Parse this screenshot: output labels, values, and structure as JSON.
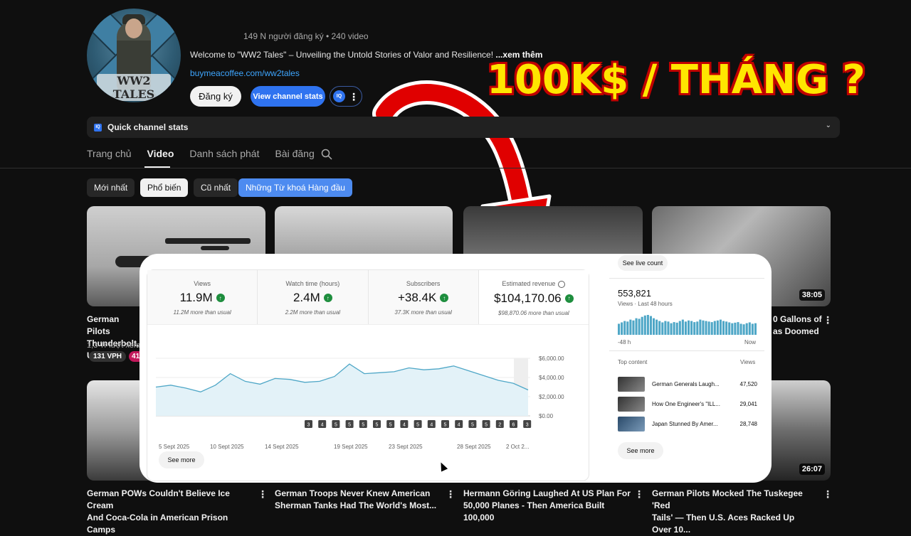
{
  "channel": {
    "avatar_text": "WW2 TALES",
    "sub_line": "149 N người đăng ký • 240 video",
    "description": "Welcome to \"WW2 Tales\" – Unveiling the Untold Stories of Valor and Resilience!",
    "more_link": "...xem thêm",
    "external_link": "buymeacoffee.com/ww2tales",
    "subscribe_label": "Đăng ký",
    "stats_button": "View channel stats",
    "iq_badge": "IQ"
  },
  "quick_stats": {
    "icon": "IQ",
    "label": "Quick channel stats"
  },
  "tabs": [
    "Trang chủ",
    "Video",
    "Danh sách phát",
    "Bài đăng"
  ],
  "chips": [
    "Mới nhất",
    "Phổ biến",
    "Cũ nhất",
    "Những Từ khoá Hàng đầu"
  ],
  "videos": [
    {
      "title_1": "German Pilots",
      "title_2": "Thunderbolt, U",
      "meta": "1,3 Tr lượt xem •",
      "vph": "131 VPH",
      "vph2": "41x"
    },
    {
      "title_1": "0 Gallons of",
      "title_2": "as Doomed",
      "duration": "38:05"
    },
    {
      "title_1": "German POWs Couldn't Believe Ice Cream",
      "title_2": "And Coca-Cola in American Prison Camps"
    },
    {
      "title_1": "German Troops Never Knew American",
      "title_2": "Sherman Tanks Had The World's Most..."
    },
    {
      "title_1": "Hermann Göring Laughed At US Plan For",
      "title_2": "50,000 Planes - Then America Built 100,000"
    },
    {
      "title_1": "German Pilots Mocked The Tuskegee 'Red",
      "title_2": "Tails' — Then U.S. Aces Racked Up Over 10...",
      "duration": "26:07"
    }
  ],
  "headline": "100K$ / THÁNG ?",
  "overlay": {
    "stats": [
      {
        "label": "Views",
        "value": "11.9M",
        "sub": "11.2M more than usual"
      },
      {
        "label": "Watch time (hours)",
        "value": "2.4M",
        "sub": "2.2M more than usual"
      },
      {
        "label": "Subscribers",
        "value": "+38.4K",
        "sub": "37.3K more than usual"
      },
      {
        "label": "Estimated revenue",
        "value": "$104,170.06",
        "sub": "$98,870.06 more than usual"
      }
    ],
    "see_more": "See more",
    "right": {
      "see_live": "See live count",
      "live_value": "553,821",
      "live_caption": "Views · Last 48 hours",
      "x_start": "-48 h",
      "x_end": "Now",
      "top_content": "Top content",
      "views_header": "Views",
      "items": [
        {
          "title": "German Generals Laugh...",
          "views": "47,520"
        },
        {
          "title": "How One Engineer's \"ILL...",
          "views": "29,041"
        },
        {
          "title": "Japan Stunned By Amer...",
          "views": "28,748"
        }
      ],
      "see_more": "See more"
    }
  },
  "chart_data": {
    "type": "area",
    "xlabels": [
      "5 Sept 2025",
      "10 Sept 2025",
      "14 Sept 2025",
      "19 Sept 2025",
      "23 Sept 2025",
      "28 Sept 2025",
      "2 Oct 2..."
    ],
    "yticks": [
      "$6,000.00",
      "$4,000.00",
      "$2,000.00",
      "$0.00"
    ],
    "ylim": [
      0,
      6000
    ],
    "values": [
      3000,
      3200,
      2900,
      2500,
      3200,
      4400,
      3600,
      3300,
      3900,
      3800,
      3500,
      3600,
      4100,
      5400,
      4400,
      4500,
      4600,
      5000,
      4800,
      4900,
      5200,
      4700,
      4200,
      3700,
      3400,
      2700
    ],
    "markers": [
      "3",
      "4",
      "5",
      "5",
      "5",
      "5",
      "5",
      "4",
      "5",
      "4",
      "5",
      "4",
      "5",
      "5",
      "2",
      "6",
      "3"
    ]
  },
  "live_chart": {
    "type": "bar",
    "values": [
      40,
      45,
      50,
      48,
      55,
      52,
      60,
      58,
      65,
      70,
      72,
      68,
      60,
      55,
      50,
      45,
      50,
      48,
      42,
      46,
      44,
      50,
      55,
      48,
      52,
      50,
      46,
      48,
      55,
      52,
      50,
      48,
      46,
      50,
      52,
      55,
      50,
      48,
      45,
      42,
      44,
      46,
      40,
      38,
      42,
      45,
      40,
      42
    ]
  },
  "colors": {
    "accent": "#2f73f0",
    "headline": "#ffe600",
    "arrow": "#e00000",
    "chart": "#4fa7c7"
  }
}
